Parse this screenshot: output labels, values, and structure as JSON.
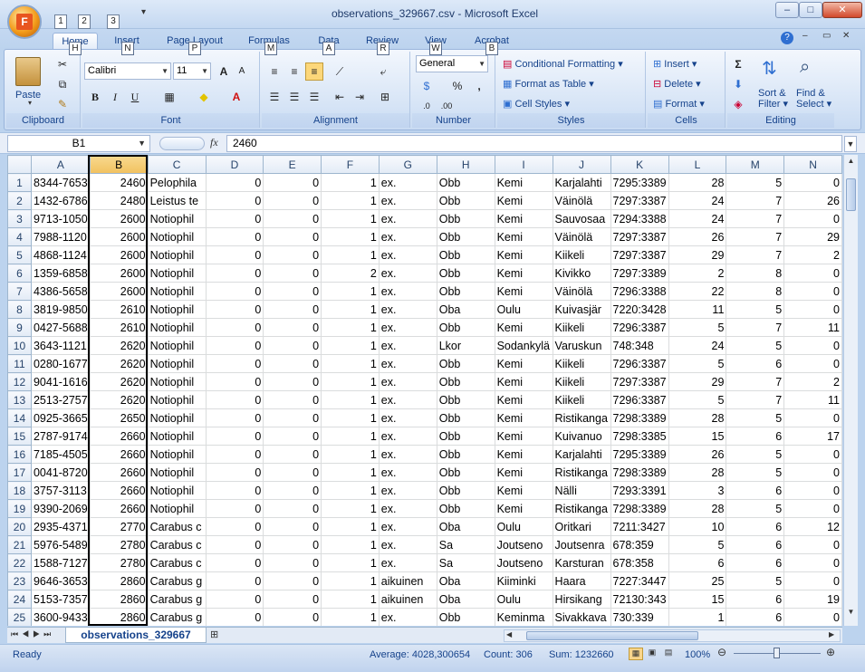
{
  "window": {
    "title": "observations_329667.csv - Microsoft Excel",
    "qat_keytips": [
      "1",
      "2",
      "3"
    ]
  },
  "tabs": [
    {
      "label": "Home",
      "keytip": "H"
    },
    {
      "label": "Insert",
      "keytip": "N"
    },
    {
      "label": "Page Layout",
      "keytip": "P"
    },
    {
      "label": "Formulas",
      "keytip": "M"
    },
    {
      "label": "Data",
      "keytip": "A"
    },
    {
      "label": "Review",
      "keytip": "R"
    },
    {
      "label": "View",
      "keytip": "W"
    },
    {
      "label": "Acrobat",
      "keytip": "B"
    }
  ],
  "ribbon": {
    "clipboard": {
      "label": "Clipboard",
      "paste": "Paste"
    },
    "font": {
      "label": "Font",
      "name": "Calibri",
      "size": "11",
      "bold": "B",
      "italic": "I",
      "underline": "U",
      "grow": "A",
      "shrink": "A"
    },
    "alignment": {
      "label": "Alignment"
    },
    "number": {
      "label": "Number",
      "format": "General",
      "percent": "%",
      "comma": ","
    },
    "styles": {
      "label": "Styles",
      "conditional": "Conditional Formatting",
      "format_table": "Format as Table",
      "cell_styles": "Cell Styles"
    },
    "cells": {
      "label": "Cells",
      "insert": "Insert",
      "delete": "Delete",
      "format": "Format"
    },
    "editing": {
      "label": "Editing",
      "sum": "Σ",
      "sort_filter_1": "Sort &",
      "sort_filter_2": "Filter",
      "find_select_1": "Find &",
      "find_select_2": "Select"
    }
  },
  "formula_bar": {
    "name_box": "B1",
    "fx": "fx",
    "value": "2460"
  },
  "columns": [
    "A",
    "B",
    "C",
    "D",
    "E",
    "F",
    "G",
    "H",
    "I",
    "J",
    "K",
    "L",
    "M",
    "N"
  ],
  "rows": [
    [
      "1",
      "8344-7653",
      "2460",
      "Pelophila",
      "0",
      "0",
      "1",
      "ex.",
      "Obb",
      "Kemi",
      "Karjalahti",
      "7295:3389",
      "28",
      "5",
      "0"
    ],
    [
      "2",
      "1432-6786",
      "2480",
      "Leistus te",
      "0",
      "0",
      "1",
      "ex.",
      "Obb",
      "Kemi",
      "Väinölä",
      "7297:3387",
      "24",
      "7",
      "26"
    ],
    [
      "3",
      "9713-1050",
      "2600",
      "Notiophil",
      "0",
      "0",
      "1",
      "ex.",
      "Obb",
      "Kemi",
      "Sauvosaa",
      "7294:3388",
      "24",
      "7",
      "0"
    ],
    [
      "4",
      "7988-1120",
      "2600",
      "Notiophil",
      "0",
      "0",
      "1",
      "ex.",
      "Obb",
      "Kemi",
      "Väinölä",
      "7297:3387",
      "26",
      "7",
      "29"
    ],
    [
      "5",
      "4868-1124",
      "2600",
      "Notiophil",
      "0",
      "0",
      "1",
      "ex.",
      "Obb",
      "Kemi",
      "Kiikeli",
      "7297:3387",
      "29",
      "7",
      "2"
    ],
    [
      "6",
      "1359-6858",
      "2600",
      "Notiophil",
      "0",
      "0",
      "2",
      "ex.",
      "Obb",
      "Kemi",
      "Kivikko",
      "7297:3389",
      "2",
      "8",
      "0"
    ],
    [
      "7",
      "4386-5658",
      "2600",
      "Notiophil",
      "0",
      "0",
      "1",
      "ex.",
      "Obb",
      "Kemi",
      "Väinölä",
      "7296:3388",
      "22",
      "8",
      "0"
    ],
    [
      "8",
      "3819-9850",
      "2610",
      "Notiophil",
      "0",
      "0",
      "1",
      "ex.",
      "Oba",
      "Oulu",
      "Kuivasjär",
      "7220:3428",
      "11",
      "5",
      "0"
    ],
    [
      "9",
      "0427-5688",
      "2610",
      "Notiophil",
      "0",
      "0",
      "1",
      "ex.",
      "Obb",
      "Kemi",
      "Kiikeli",
      "7296:3387",
      "5",
      "7",
      "11"
    ],
    [
      "10",
      "3643-1121",
      "2620",
      "Notiophil",
      "0",
      "0",
      "1",
      "ex.",
      "Lkor",
      "Sodankylä",
      "Varuskun",
      "748:348",
      "24",
      "5",
      "0"
    ],
    [
      "11",
      "0280-1677",
      "2620",
      "Notiophil",
      "0",
      "0",
      "1",
      "ex.",
      "Obb",
      "Kemi",
      "Kiikeli",
      "7296:3387",
      "5",
      "6",
      "0"
    ],
    [
      "12",
      "9041-1616",
      "2620",
      "Notiophil",
      "0",
      "0",
      "1",
      "ex.",
      "Obb",
      "Kemi",
      "Kiikeli",
      "7297:3387",
      "29",
      "7",
      "2"
    ],
    [
      "13",
      "2513-2757",
      "2620",
      "Notiophil",
      "0",
      "0",
      "1",
      "ex.",
      "Obb",
      "Kemi",
      "Kiikeli",
      "7296:3387",
      "5",
      "7",
      "11"
    ],
    [
      "14",
      "0925-3665",
      "2650",
      "Notiophil",
      "0",
      "0",
      "1",
      "ex.",
      "Obb",
      "Kemi",
      "Ristikanga",
      "7298:3389",
      "28",
      "5",
      "0"
    ],
    [
      "15",
      "2787-9174",
      "2660",
      "Notiophil",
      "0",
      "0",
      "1",
      "ex.",
      "Obb",
      "Kemi",
      "Kuivanuo",
      "7298:3385",
      "15",
      "6",
      "17"
    ],
    [
      "16",
      "7185-4505",
      "2660",
      "Notiophil",
      "0",
      "0",
      "1",
      "ex.",
      "Obb",
      "Kemi",
      "Karjalahti",
      "7295:3389",
      "26",
      "5",
      "0"
    ],
    [
      "17",
      "0041-8720",
      "2660",
      "Notiophil",
      "0",
      "0",
      "1",
      "ex.",
      "Obb",
      "Kemi",
      "Ristikanga",
      "7298:3389",
      "28",
      "5",
      "0"
    ],
    [
      "18",
      "3757-3113",
      "2660",
      "Notiophil",
      "0",
      "0",
      "1",
      "ex.",
      "Obb",
      "Kemi",
      "Nälli",
      "7293:3391",
      "3",
      "6",
      "0"
    ],
    [
      "19",
      "9390-2069",
      "2660",
      "Notiophil",
      "0",
      "0",
      "1",
      "ex.",
      "Obb",
      "Kemi",
      "Ristikanga",
      "7298:3389",
      "28",
      "5",
      "0"
    ],
    [
      "20",
      "2935-4371",
      "2770",
      "Carabus c",
      "0",
      "0",
      "1",
      "ex.",
      "Oba",
      "Oulu",
      "Oritkari",
      "7211:3427",
      "10",
      "6",
      "12"
    ],
    [
      "21",
      "5976-5489",
      "2780",
      "Carabus c",
      "0",
      "0",
      "1",
      "ex.",
      "Sa",
      "Joutseno",
      "Joutsenra",
      "678:359",
      "5",
      "6",
      "0"
    ],
    [
      "22",
      "1588-7127",
      "2780",
      "Carabus c",
      "0",
      "0",
      "1",
      "ex.",
      "Sa",
      "Joutseno",
      "Karsturan",
      "678:358",
      "6",
      "6",
      "0"
    ],
    [
      "23",
      "9646-3653",
      "2860",
      "Carabus g",
      "0",
      "0",
      "1",
      "aikuinen",
      "Oba",
      "Kiiminki",
      "Haara",
      "7227:3447",
      "25",
      "5",
      "0"
    ],
    [
      "24",
      "5153-7357",
      "2860",
      "Carabus g",
      "0",
      "0",
      "1",
      "aikuinen",
      "Oba",
      "Oulu",
      "Hirsikang",
      "72130:343",
      "15",
      "6",
      "19"
    ],
    [
      "25",
      "3600-9433",
      "2860",
      "Carabus g",
      "0",
      "0",
      "1",
      "ex.",
      "Obb",
      "Keminma",
      "Sivakkava",
      "730:339",
      "1",
      "6",
      "0"
    ]
  ],
  "sheet_tab": "observations_329667",
  "status": {
    "ready": "Ready",
    "average": "Average: 4028,300654",
    "count": "Count: 306",
    "sum": "Sum: 1232660",
    "zoom": "100%"
  }
}
